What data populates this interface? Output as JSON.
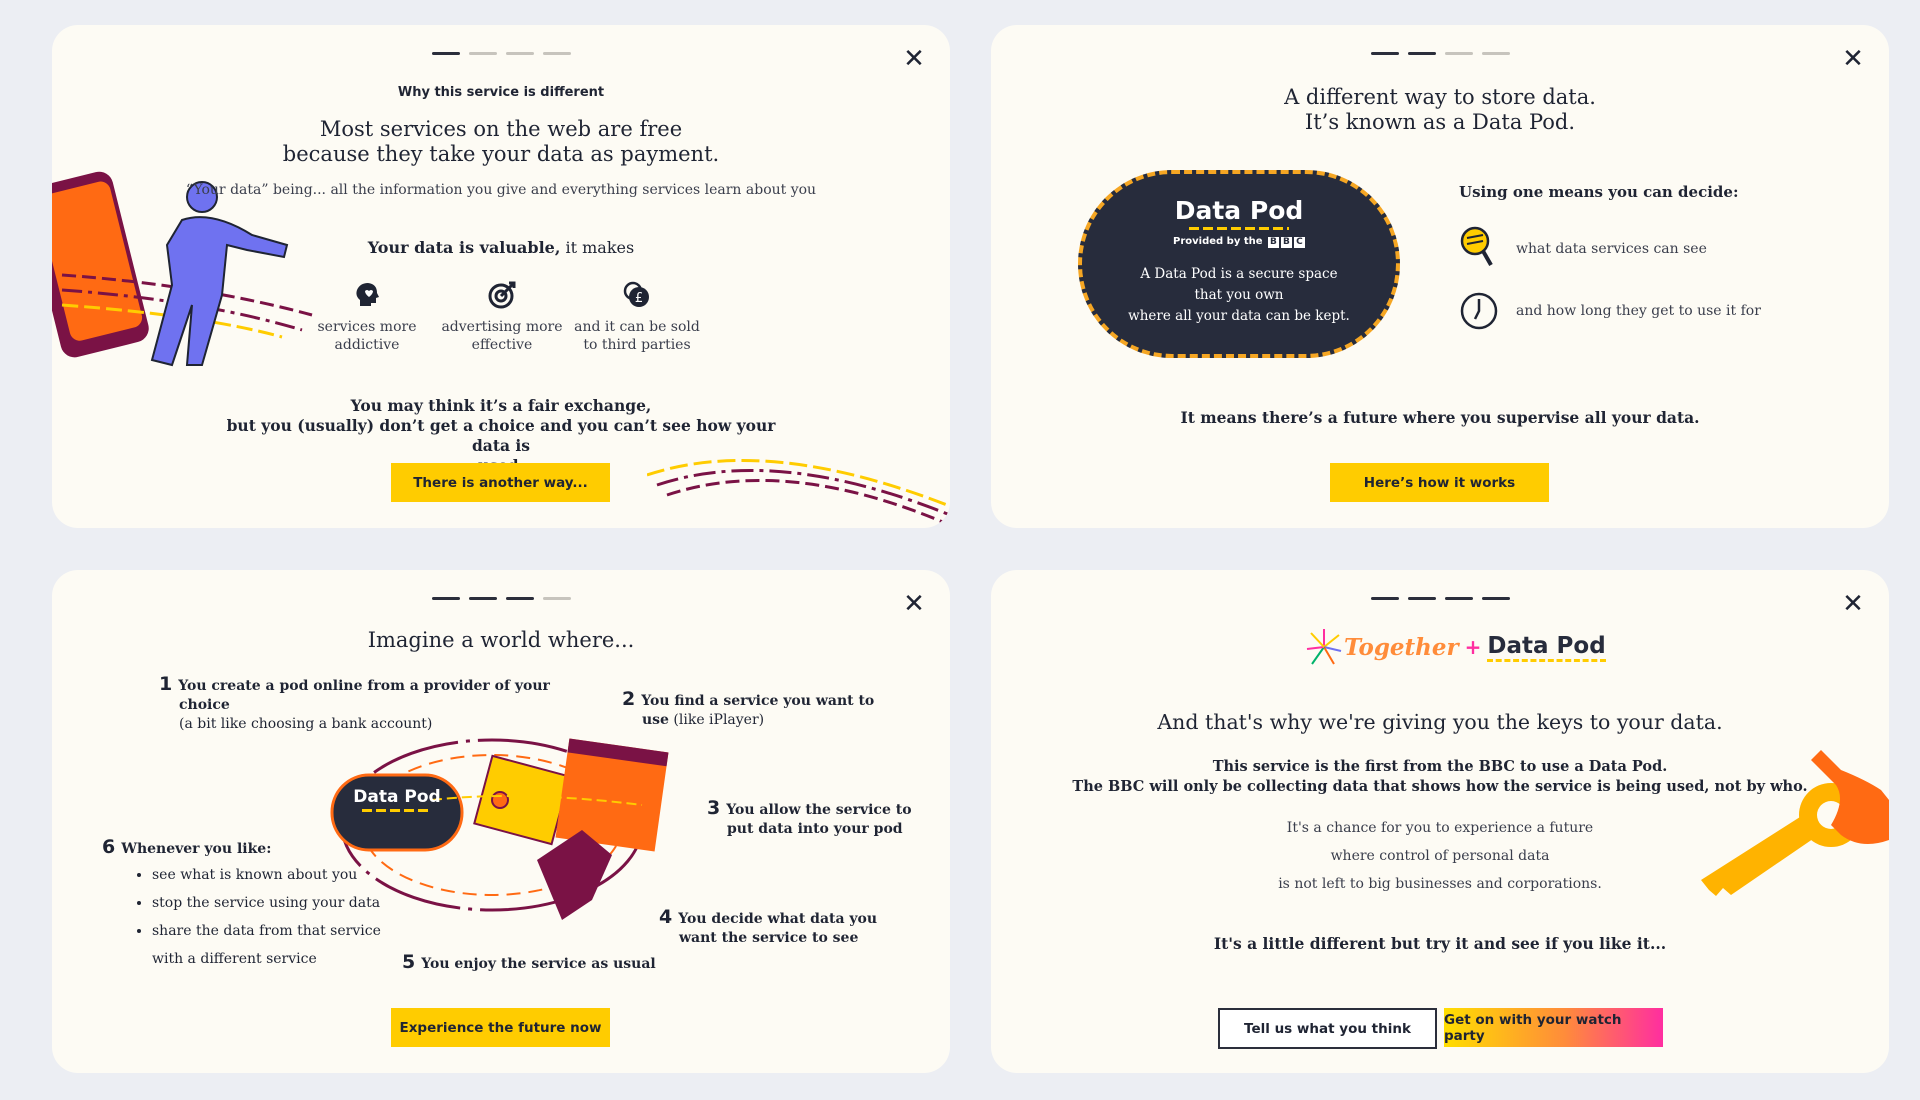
{
  "card1": {
    "eyebrow": "Why this service is different",
    "title_line1": "Most services on the web are free",
    "title_line2": "because they take your data as payment.",
    "definition": "“Your data” being... all the information you give and everything services learn about you",
    "valuable_bold": "Your data is valuable,",
    "valuable_rest": " it makes",
    "benefits": [
      {
        "icon": "head-heart-icon",
        "line1": "services more",
        "line2": "addictive"
      },
      {
        "icon": "target-icon",
        "line1": "advertising more",
        "line2": "effective"
      },
      {
        "icon": "coins-pound-icon",
        "line1": "and it can be sold",
        "line2": "to third parties"
      }
    ],
    "exchange_line1": "You may think it’s a fair exchange,",
    "exchange_line2": "but you (usually) don’t get a choice and you can’t see how your data is",
    "exchange_line3": "used.",
    "button": "There is another way..."
  },
  "card2": {
    "title_line1": "A different way to store data.",
    "title_line2": "It’s known as a Data Pod.",
    "pod_title": "Data Pod",
    "pod_provided": "Provided by the",
    "pod_bbc": [
      "B",
      "B",
      "C"
    ],
    "pod_desc1": "A Data Pod is a secure space",
    "pod_desc2": "that you own",
    "pod_desc3": "where all your data can be kept.",
    "decide_title": "Using one means you can decide:",
    "decide_items": [
      {
        "icon": "magnifier-icon",
        "text": "what data services can see"
      },
      {
        "icon": "clock-icon",
        "text": "and how long they get to use it for"
      }
    ],
    "future": "It means there’s a future where you supervise all your data.",
    "button": "Here’s how it works"
  },
  "card3": {
    "title": "Imagine a world where...",
    "steps": [
      {
        "num": "1",
        "bold1": "You create a pod online from a provider of your",
        "bold2": "choice",
        "plain": "(a bit like choosing a bank account)"
      },
      {
        "num": "2",
        "bold1": "You find a service you want to",
        "bold2": "use",
        "plain": " (like iPlayer)"
      },
      {
        "num": "3",
        "bold1": "You allow the service to",
        "bold2": "put data into your pod"
      },
      {
        "num": "4",
        "bold1": "You decide what data you",
        "bold2": "want the service to see"
      },
      {
        "num": "5",
        "bold1": "You enjoy the service as usual"
      },
      {
        "num": "6",
        "bold1": "Whenever you like:"
      }
    ],
    "bullets": [
      "see what is known about you",
      "stop the service using your data",
      "share the data from that service",
      "with a different service"
    ],
    "pod_label": "Data Pod",
    "button": "Experience the future now"
  },
  "card4": {
    "logo_together": "Together",
    "logo_plus": "+",
    "logo_datapod": "Data Pod",
    "title": "And that's why we're giving you the keys to your data.",
    "bold_line1": "This service is the first from the BBC to use a Data Pod.",
    "bold_line2": "The BBC will only be collecting data that shows how the service is being used, not by who.",
    "chance1": "It's a chance for you to experience a future",
    "chance2": "where control of personal data",
    "chance3": "is not left to big businesses and corporations.",
    "try": "It's a little different but try it and see if you like it...",
    "btn_feedback": "Tell us what you think",
    "btn_watch": "Get on with your watch party"
  },
  "colors": {
    "accent": "#ffcc00",
    "navy": "#272c3c",
    "orange": "#ff6a13",
    "maroon": "#7a1245",
    "purple": "#6f72f0"
  }
}
